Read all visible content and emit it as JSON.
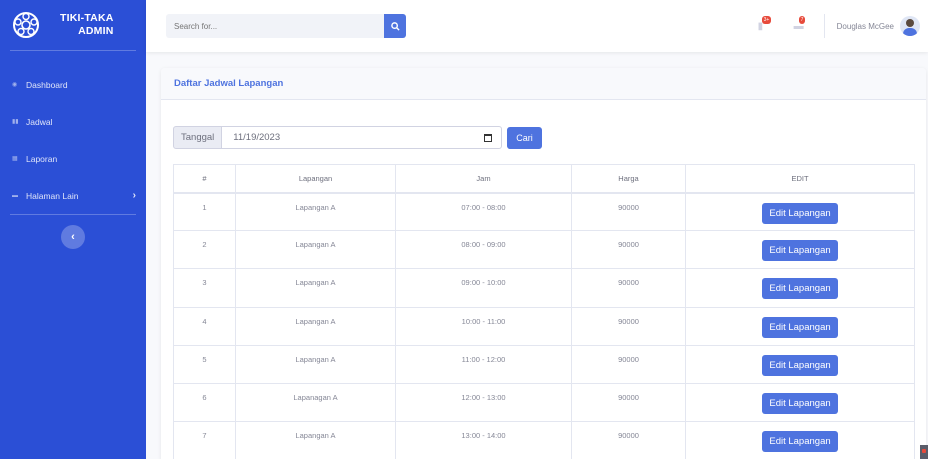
{
  "brand": {
    "line1": "TIKI-TAKA",
    "line2": "ADMIN"
  },
  "sidebar": {
    "items": [
      {
        "label": "Dashboard",
        "icon": "dashboard-icon"
      },
      {
        "label": "Jadwal",
        "icon": "chart-icon"
      },
      {
        "label": "Laporan",
        "icon": "table-icon"
      },
      {
        "label": "Halaman Lain",
        "icon": "folder-icon",
        "has_chevron": true
      }
    ]
  },
  "topbar": {
    "search_placeholder": "Search for...",
    "alerts_count": "3+",
    "messages_count": "7",
    "user_name": "Douglas McGee"
  },
  "card": {
    "title": "Daftar Jadwal Lapangan",
    "filter_label": "Tanggal",
    "filter_date": "11/19/2023",
    "search_button": "Cari"
  },
  "table": {
    "headers": [
      "#",
      "Lapangan",
      "Jam",
      "Harga",
      "EDIT"
    ],
    "rows": [
      {
        "no": "1",
        "lapangan": "Lapangan A",
        "jam": "07:00 - 08:00",
        "harga": "90000",
        "edit": "Edit Lapangan"
      },
      {
        "no": "2",
        "lapangan": "Lapangan A",
        "jam": "08:00 - 09:00",
        "harga": "90000",
        "edit": "Edit Lapangan"
      },
      {
        "no": "3",
        "lapangan": "Lapangan A",
        "jam": "09:00 - 10:00",
        "harga": "90000",
        "edit": "Edit Lapangan"
      },
      {
        "no": "4",
        "lapangan": "Lapangan A",
        "jam": "10:00 - 11:00",
        "harga": "90000",
        "edit": "Edit Lapangan"
      },
      {
        "no": "5",
        "lapangan": "Lapangan A",
        "jam": "11:00 - 12:00",
        "harga": "90000",
        "edit": "Edit Lapangan"
      },
      {
        "no": "6",
        "lapangan": "Lapanagan A",
        "jam": "12:00 - 13:00",
        "harga": "90000",
        "edit": "Edit Lapangan"
      },
      {
        "no": "7",
        "lapangan": "Lapangan A",
        "jam": "13:00 - 14:00",
        "harga": "90000",
        "edit": "Edit Lapangan"
      }
    ]
  },
  "colors": {
    "sidebar": "#2b4fd6",
    "primary": "#4e73df",
    "badge": "#e74a3b"
  }
}
